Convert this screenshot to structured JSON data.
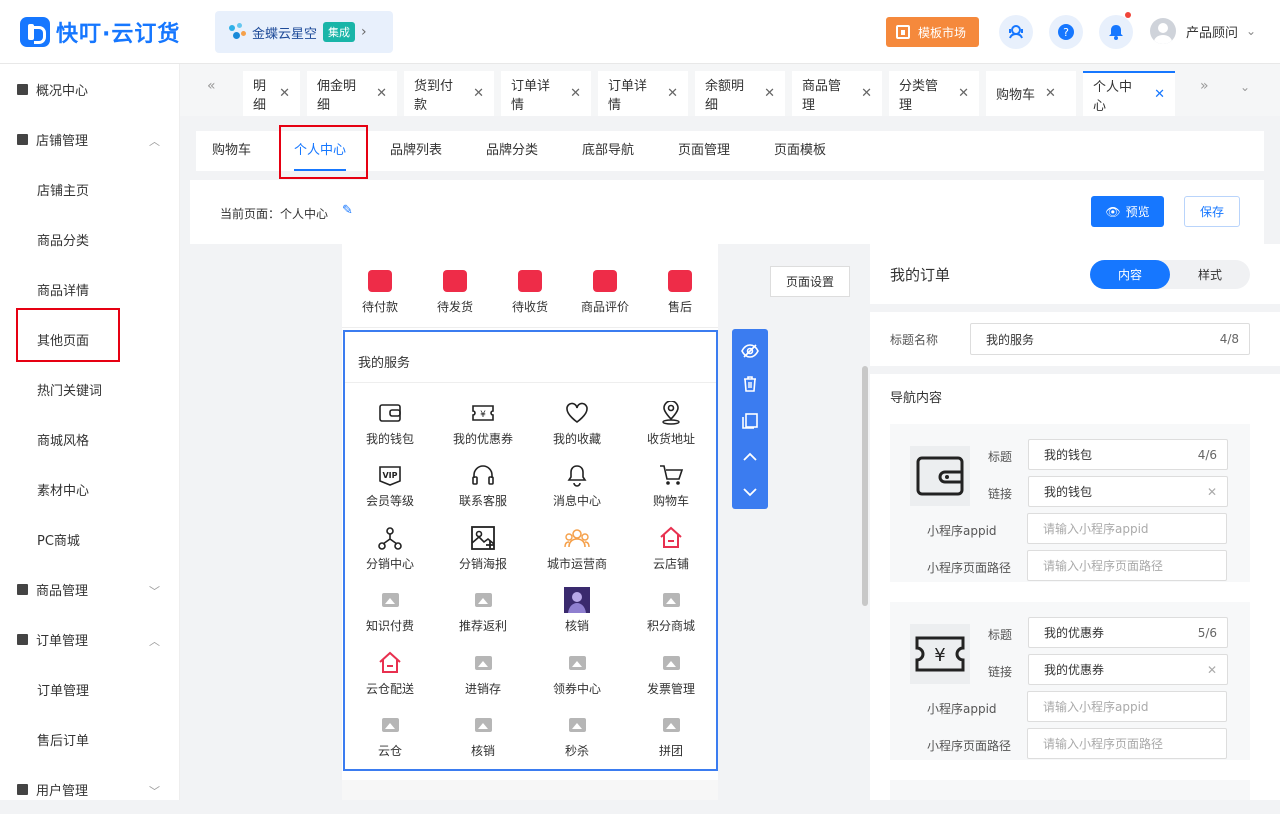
{
  "app": {
    "brand": "快叮·云订货"
  },
  "header": {
    "kingdee_label": "金蝶云星空",
    "kingdee_badge": "集成",
    "market_label": "模板市场",
    "user_name": "产品顾问"
  },
  "sidebar": {
    "overview": "概况中心",
    "shop": "店铺管理",
    "shop_items": [
      "店铺主页",
      "商品分类",
      "商品详情",
      "其他页面",
      "热门关键词",
      "商城风格",
      "素材中心",
      "PC商城"
    ],
    "goods": "商品管理",
    "order": "订单管理",
    "order_items": [
      "订单管理",
      "售后订单"
    ],
    "user": "用户管理"
  },
  "tabs": [
    "明细",
    "佣金明细",
    "货到付款",
    "订单详情",
    "订单详情",
    "余额明细",
    "商品管理",
    "分类管理",
    "购物车",
    "个人中心"
  ],
  "subtabs": [
    "购物车",
    "个人中心",
    "品牌列表",
    "品牌分类",
    "底部导航",
    "页面管理",
    "页面模板"
  ],
  "current_page": {
    "label": "当前页面：个人中心"
  },
  "actions": {
    "preview": "预览",
    "save": "保存",
    "page_settings": "页面设置"
  },
  "orders": [
    "待付款",
    "待发货",
    "待收货",
    "商品评价",
    "售后"
  ],
  "services": {
    "title": "我的服务",
    "items": [
      "我的钱包",
      "我的优惠券",
      "我的收藏",
      "收货地址",
      "会员等级",
      "联系客服",
      "消息中心",
      "购物车",
      "分销中心",
      "分销海报",
      "城市运营商",
      "云店铺",
      "知识付费",
      "推荐返利",
      "核销",
      "积分商城",
      "云仓配送",
      "进销存",
      "领券中心",
      "发票管理",
      "云仓",
      "核销",
      "秒杀",
      "拼团"
    ],
    "icons": [
      "wallet-icon",
      "coupon-icon",
      "heart-icon",
      "location-icon",
      "vip-icon",
      "headset-icon",
      "bell-icon",
      "cart-icon",
      "share-tree-icon",
      "poster-icon",
      "city-operator-icon",
      "shop-house-icon",
      "image-placeholder-icon",
      "image-placeholder-icon",
      "avatar-thumbnail",
      "image-placeholder-icon",
      "warehouse-house-icon",
      "image-placeholder-icon",
      "image-placeholder-icon",
      "image-placeholder-icon",
      "image-placeholder-icon",
      "image-placeholder-icon",
      "image-placeholder-icon",
      "image-placeholder-icon"
    ]
  },
  "right_panel": {
    "title": "我的订单",
    "seg_content": "内容",
    "seg_style": "样式",
    "title_name_label": "标题名称",
    "title_name_value": "我的服务",
    "title_name_count": "4/8",
    "nav_content_label": "导航内容",
    "field_title": "标题",
    "field_link": "链接",
    "field_appid": "小程序appid",
    "field_path": "小程序页面路径",
    "appid_placeholder": "请输入小程序appid",
    "path_placeholder": "请输入小程序页面路径",
    "cards": [
      {
        "title": "我的钱包",
        "count": "4/6",
        "link": "我的钱包"
      },
      {
        "title": "我的优惠券",
        "count": "5/6",
        "link": "我的优惠券"
      }
    ]
  },
  "colors": {
    "accent": "#1677ff",
    "danger": "#e60012",
    "market": "#f5893c",
    "order_red": "#ee2c48",
    "service_red": "#ee2c48",
    "orange": "#f5a04a"
  }
}
